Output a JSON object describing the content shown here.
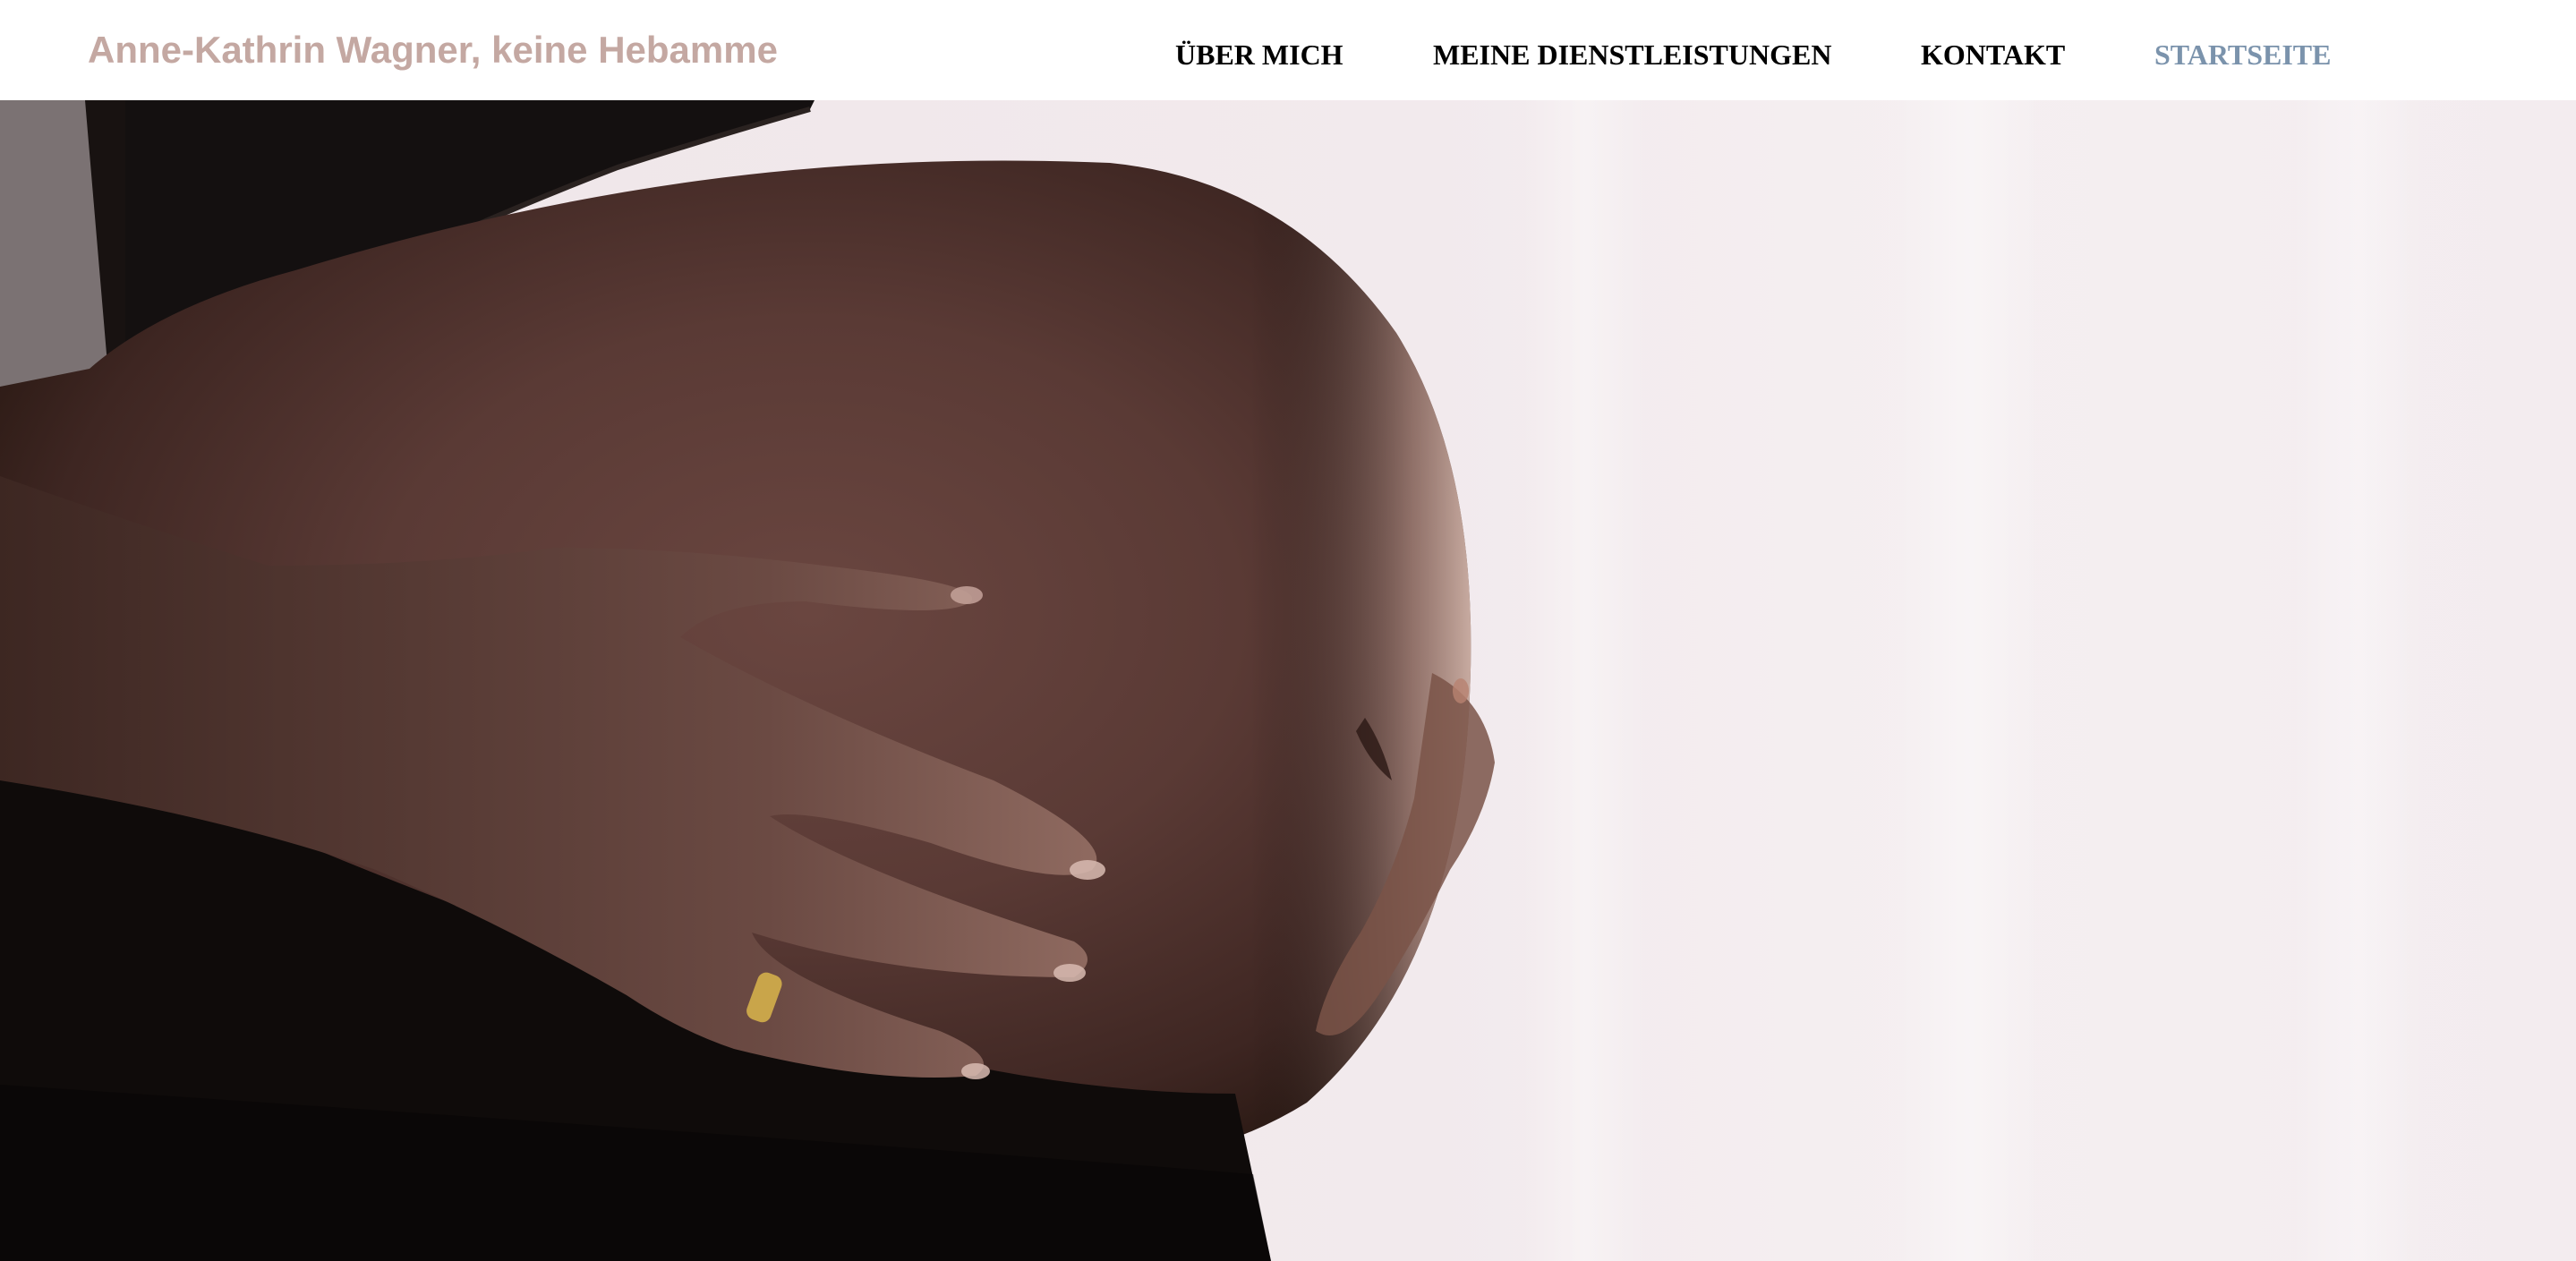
{
  "header": {
    "site_title": "Anne-Kathrin Wagner, keine Hebamme",
    "nav": [
      {
        "label": "ÜBER MICH",
        "active": false
      },
      {
        "label": "MEINE DIENSTLEISTUNGEN",
        "active": false
      },
      {
        "label": "KONTAKT",
        "active": false
      },
      {
        "label": "STARTSEITE",
        "active": true
      }
    ]
  },
  "colors": {
    "site_title": "#c4a8a2",
    "nav_text": "#000000",
    "nav_active": "#7b93ac",
    "header_background": "#ffffff"
  }
}
